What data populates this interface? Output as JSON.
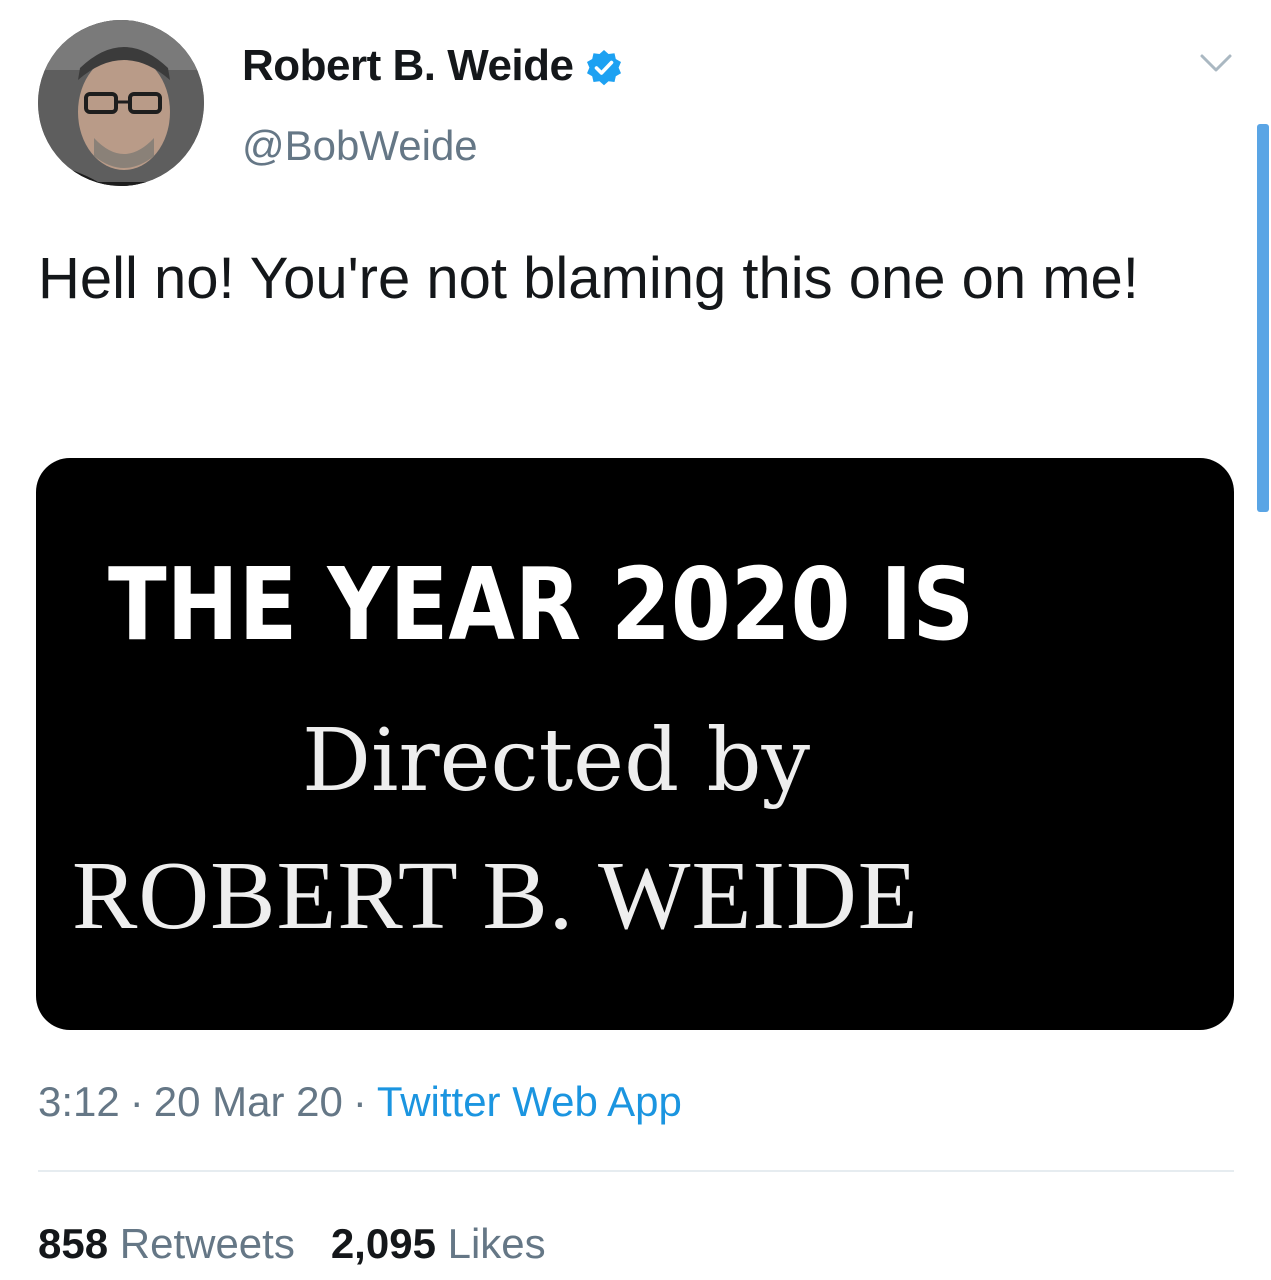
{
  "author": {
    "display_name": "Robert B. Weide",
    "handle": "@BobWeide",
    "verified_icon": "verified-badge-icon",
    "verified_color": "#1da1f2"
  },
  "tweet": {
    "text": "Hell no! You're not blaming this one on me!"
  },
  "media": {
    "line1": "THE YEAR 2020 IS",
    "line2": "Directed by",
    "line3": "ROBERT B. WEIDE"
  },
  "meta": {
    "time": "3:12",
    "separator": "·",
    "date": "20 Mar 20",
    "source": "Twitter Web App",
    "source_color": "#1b95e0"
  },
  "stats": {
    "retweets_count": "858",
    "retweets_label": "Retweets",
    "likes_count": "2,095",
    "likes_label": "Likes"
  },
  "icons": {
    "caret": "chevron-down-icon"
  }
}
